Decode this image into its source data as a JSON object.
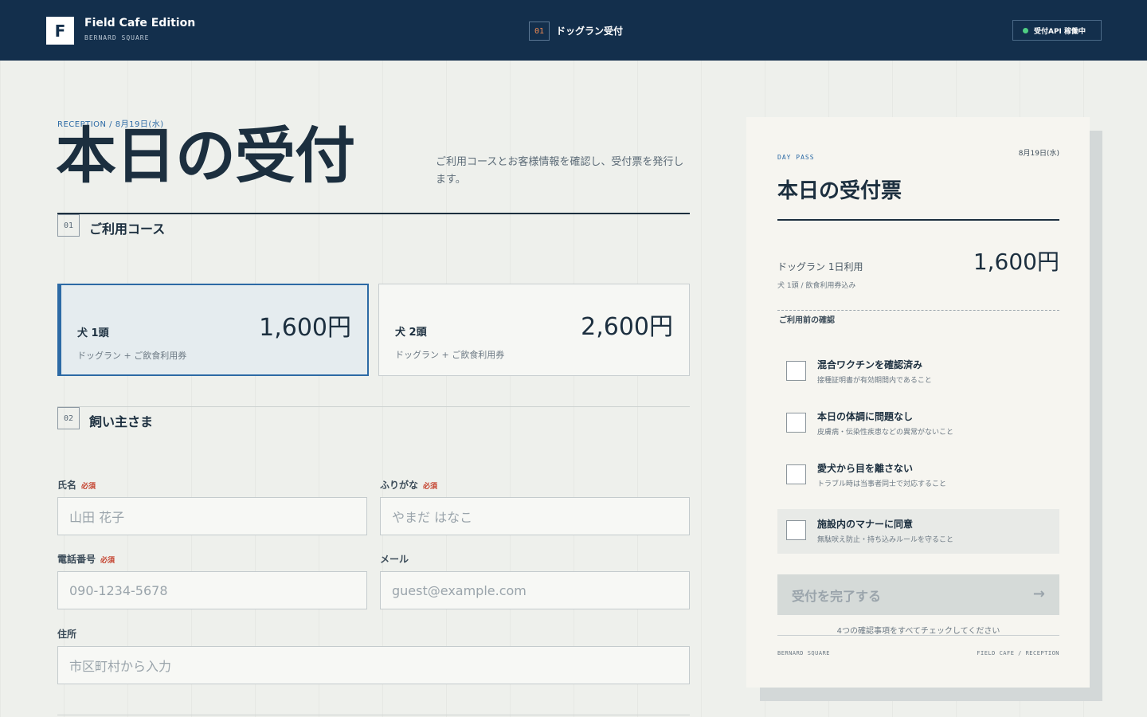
{
  "header": {
    "logo_letter": "F",
    "brand_name": "Field Cafe Edition",
    "brand_sub": "BERNARD SQUARE",
    "step_number": "01",
    "step_label": "ドッグラン受付",
    "api_status": "受付API 稼働中",
    "api_status_color": "#4fcf83"
  },
  "page": {
    "eyebrow": "RECEPTION / 8月19日(水)",
    "title": "本日の受付",
    "description": "ご利用コースとお客様情報を確認し、受付票を発行します。"
  },
  "course_section": {
    "number": "01",
    "title": "ご利用コース",
    "options": [
      {
        "name": "犬 1頭",
        "detail": "ドッグラン + ご飲食利用券",
        "price": "1,600円",
        "selected": true
      },
      {
        "name": "犬 2頭",
        "detail": "ドッグラン + ご飲食利用券",
        "price": "2,600円",
        "selected": false
      }
    ]
  },
  "owner_section": {
    "number": "02",
    "title": "飼い主さま",
    "required_label": "必須",
    "fields": {
      "name": {
        "label": "氏名",
        "placeholder": "山田 花子"
      },
      "kana": {
        "label": "ふりがな",
        "placeholder": "やまだ はなこ"
      },
      "phone": {
        "label": "電話番号",
        "placeholder": "090-1234-5678"
      },
      "email": {
        "label": "メール",
        "placeholder": "guest@example.com"
      },
      "address": {
        "label": "住所",
        "placeholder": "市区町村から入力"
      }
    }
  },
  "ticket": {
    "pass_label": "DAY PASS",
    "date": "8月19日(水)",
    "title": "本日の受付票",
    "item": "ドッグラン 1日利用",
    "item_sub": "犬 1頭 / 飲食利用券込み",
    "price": "1,600円",
    "check_heading": "ご利用前の確認",
    "checks": [
      {
        "title": "混合ワクチンを確認済み",
        "sub": "接種証明書が有効期間内であること",
        "checked": false
      },
      {
        "title": "本日の体調に問題なし",
        "sub": "皮膚病・伝染性疾患などの異常がないこと",
        "checked": false
      },
      {
        "title": "愛犬から目を離さない",
        "sub": "トラブル時は当事者同士で対応すること",
        "checked": false
      },
      {
        "title": "施設内のマナーに同意",
        "sub": "無駄吠え防止・持ち込みルールを守ること",
        "checked": false
      }
    ],
    "submit_label": "受付を完了する",
    "submit_arrow": "→",
    "hint": "4つの確認事項をすべてチェックしてください",
    "footer_left": "BERNARD SQUARE",
    "footer_right": "FIELD CAFE / RECEPTION"
  },
  "colors": {
    "header_bg": "#132f4c",
    "accent": "#2c6aa5",
    "required": "#c4402c",
    "step_number": "#f08a52"
  }
}
